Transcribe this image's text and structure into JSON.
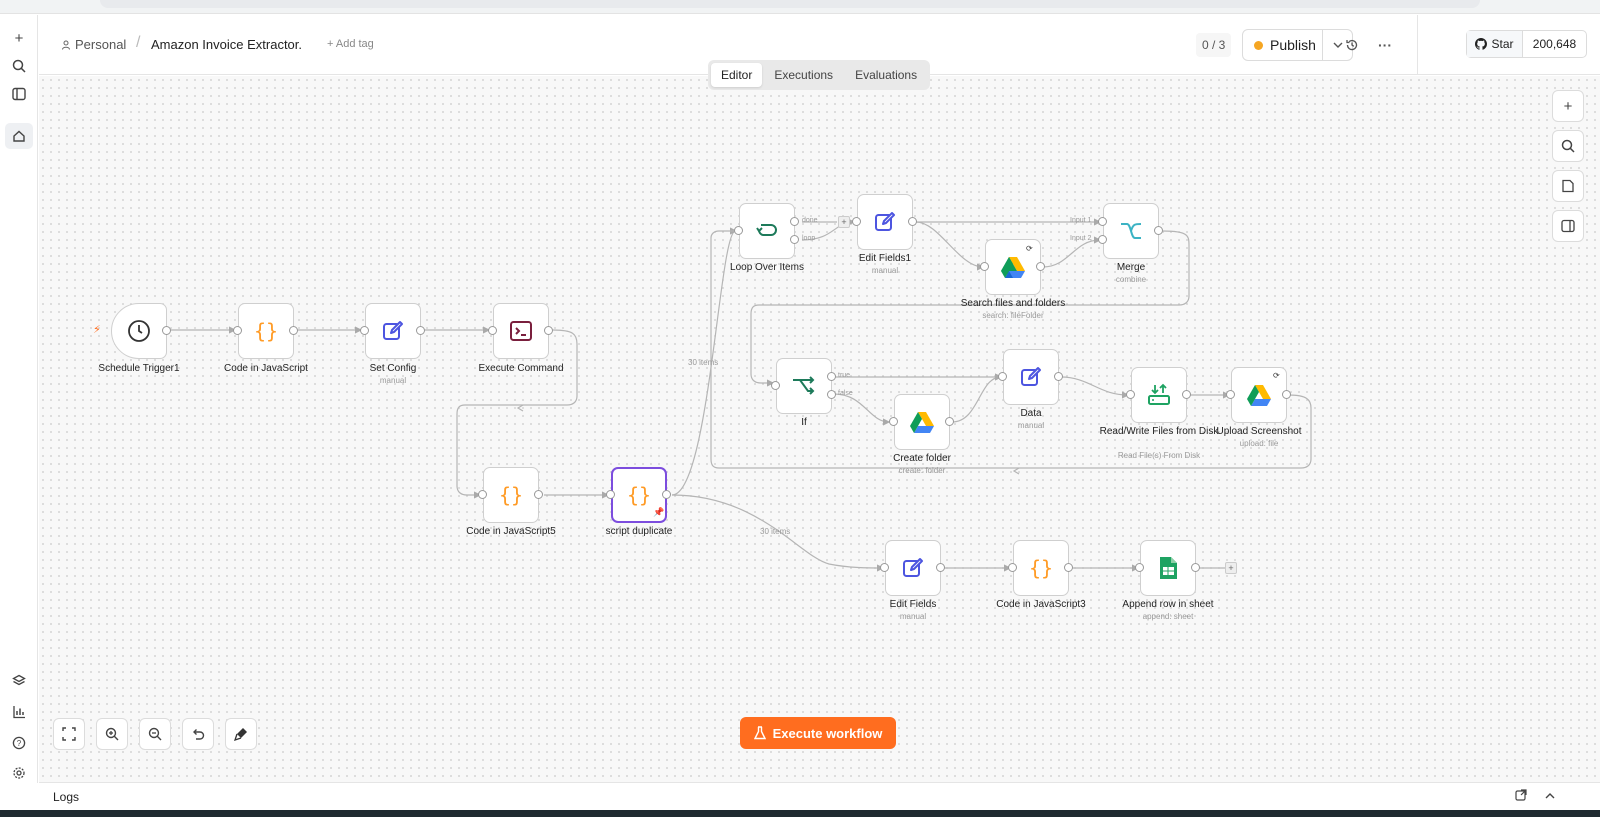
{
  "header": {
    "project": "Personal",
    "workflow_title": "Amazon Invoice Extractor.",
    "add_tag": "+ Add tag",
    "counter": "0 / 3",
    "publish_label": "Publish",
    "publish_dot_color": "#f5a623",
    "github_star_label": "Star",
    "github_star_count": "200,648"
  },
  "tabs": [
    {
      "label": "Editor",
      "active": true
    },
    {
      "label": "Executions",
      "active": false
    },
    {
      "label": "Evaluations",
      "active": false
    }
  ],
  "nodes": {
    "schedule_trigger": {
      "label": "Schedule Trigger1"
    },
    "code_js": {
      "label": "Code in JavaScript"
    },
    "set_config": {
      "label": "Set Config",
      "sub": "manual"
    },
    "execute_command": {
      "label": "Execute Command"
    },
    "code_js5": {
      "label": "Code in JavaScript5"
    },
    "script_duplicate": {
      "label": "script duplicate"
    },
    "loop_over_items": {
      "label": "Loop Over Items",
      "out_done": "done",
      "out_loop": "loop"
    },
    "edit_fields1": {
      "label": "Edit Fields1",
      "sub": "manual"
    },
    "search_files": {
      "label": "Search files and folders",
      "sub": "search: fileFolder"
    },
    "merge": {
      "label": "Merge",
      "sub": "combine",
      "in1": "Input 1",
      "in2": "Input 2"
    },
    "if_node": {
      "label": "If",
      "out_true": "true",
      "out_false": "false"
    },
    "create_folder": {
      "label": "Create folder",
      "sub": "create: folder"
    },
    "data": {
      "label": "Data",
      "sub": "manual"
    },
    "read_write": {
      "label": "Read/Write Files from Disk",
      "sub": "Read File(s) From Disk"
    },
    "upload_screenshot": {
      "label": "Upload Screenshot",
      "sub": "upload: file"
    },
    "edit_fields": {
      "label": "Edit Fields",
      "sub": "manual"
    },
    "code_js3": {
      "label": "Code in JavaScript3"
    },
    "append_row": {
      "label": "Append row in sheet",
      "sub": "append: sheet"
    }
  },
  "edge_labels": {
    "to_loop": "30 items",
    "to_edit_fields": "30 items"
  },
  "execute_button": "Execute workflow",
  "logs_label": "Logs",
  "colors": {
    "accent_orange": "#ff6d1f",
    "selected_purple": "#7c4dde",
    "code_orange": "#ff9b26",
    "edit_blue": "#4d55e0",
    "loop_green": "#1d7a5a",
    "terminal_maroon": "#7a1f3d",
    "merge_teal": "#3bb3c4",
    "sheets_green": "#1ea362"
  }
}
